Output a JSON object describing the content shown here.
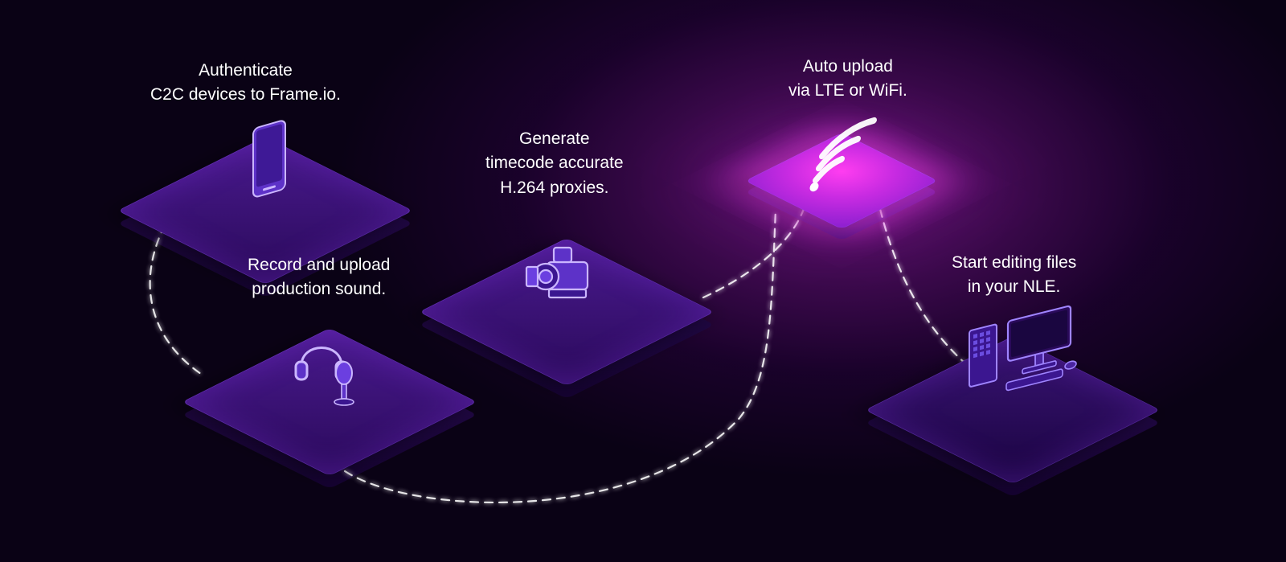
{
  "steps": {
    "authenticate": {
      "label": "Authenticate\nC2C devices to Frame.io.",
      "icon": "phone-icon"
    },
    "record": {
      "label": "Record and upload\nproduction sound.",
      "icon": "audio-icon"
    },
    "generate": {
      "label": "Generate\ntimecode accurate\nH.264 proxies.",
      "icon": "camera-icon"
    },
    "upload": {
      "label": "Auto upload\nvia LTE or WiFi.",
      "icon": "wifi-icon"
    },
    "edit": {
      "label": "Start editing files\nin your NLE.",
      "icon": "computer-icon"
    }
  },
  "colors": {
    "tile": "#3c1480",
    "accent": "#d83ae8",
    "bg": "#0a0215",
    "text": "#ffffff",
    "icon_stroke": "#b79dff"
  }
}
